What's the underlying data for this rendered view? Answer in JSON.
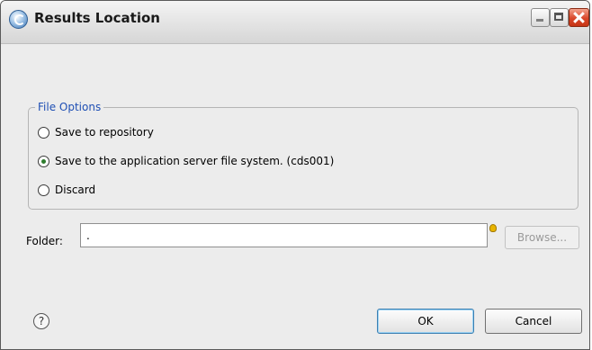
{
  "window": {
    "title": "Results Location"
  },
  "file_options": {
    "legend": "File Options",
    "options": [
      {
        "label": "Save to repository",
        "checked": false
      },
      {
        "label": "Save to the application server file system. (cds001)",
        "checked": true
      },
      {
        "label": "Discard",
        "checked": false
      }
    ]
  },
  "folder": {
    "label": "Folder:",
    "value": "."
  },
  "buttons": {
    "browse": "Browse...",
    "ok": "OK",
    "cancel": "Cancel",
    "help_glyph": "?"
  }
}
